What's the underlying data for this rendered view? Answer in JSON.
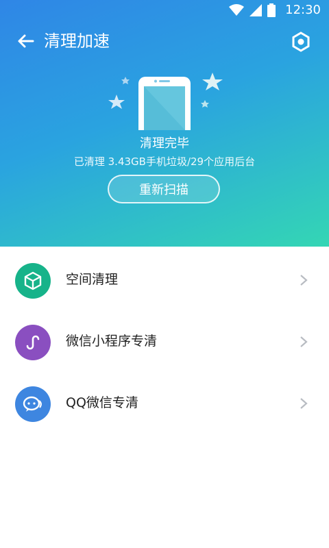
{
  "status_bar": {
    "time": "12:30"
  },
  "header": {
    "title": "清理加速"
  },
  "result": {
    "title": "清理完毕",
    "summary": "已清理 3.43GB手机垃圾/29个应用后台",
    "rescan_label": "重新扫描"
  },
  "list": {
    "items": [
      {
        "label": "空间清理",
        "icon": "box-icon",
        "color": "#17b38a"
      },
      {
        "label": "微信小程序专清",
        "icon": "mini-program-icon",
        "color": "#8a4fc0"
      },
      {
        "label": "QQ微信专清",
        "icon": "chat-bubble-icon",
        "color": "#3e86e0"
      }
    ]
  },
  "colors": {
    "hero_start": "#2f86e6",
    "hero_end": "#34d6b4"
  }
}
